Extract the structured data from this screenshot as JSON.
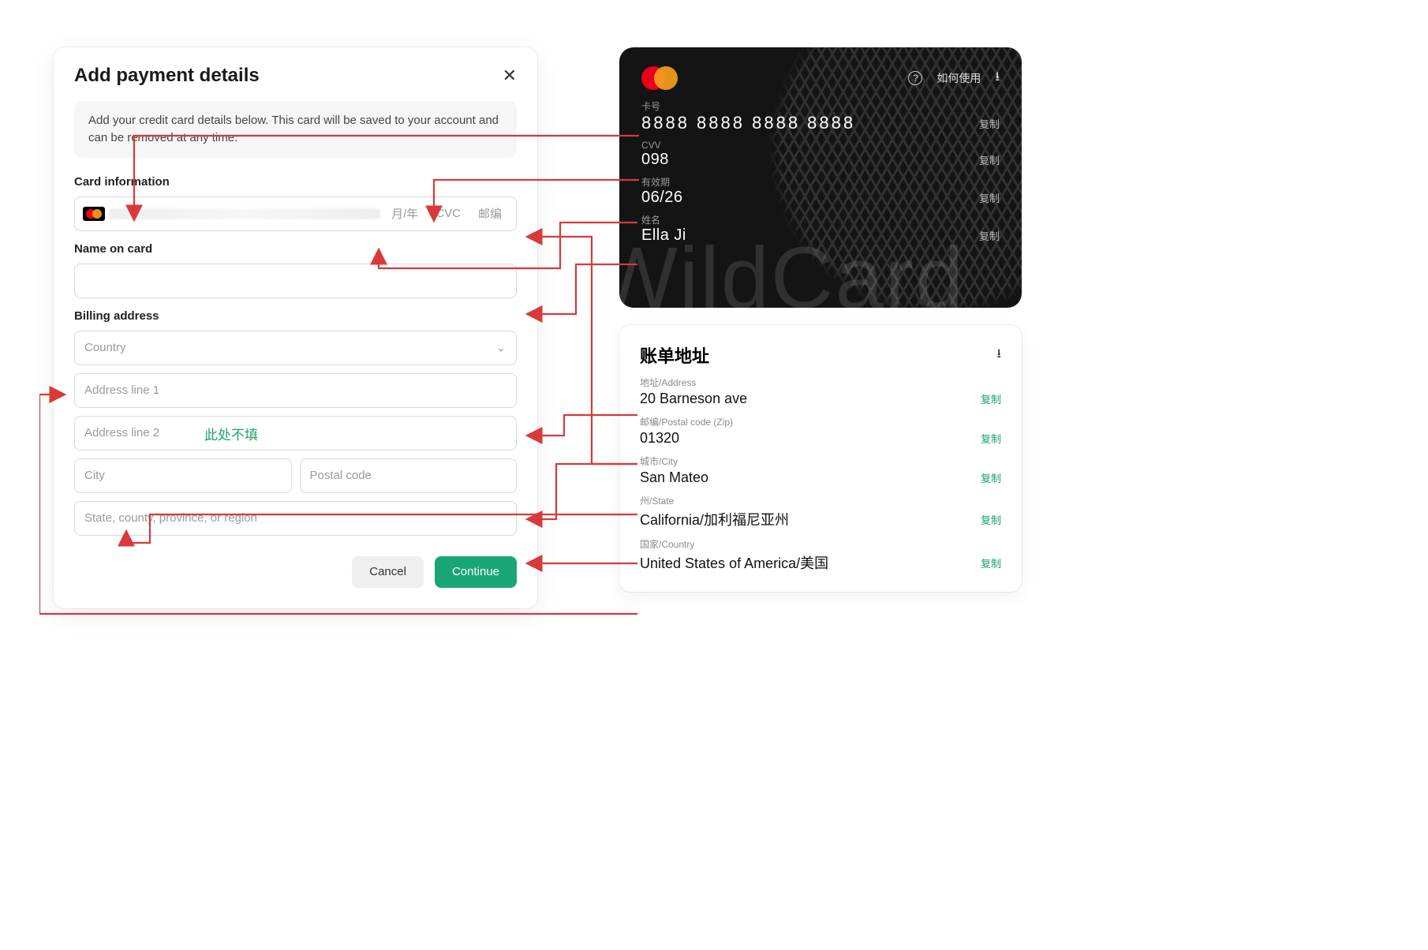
{
  "form": {
    "title": "Add payment details",
    "info": "Add your credit card details below. This card will be saved to your account and can be removed at any time.",
    "card_section_label": "Card information",
    "card_ph_monthyear": "月/年",
    "card_ph_cvc": "CVC",
    "card_ph_zip": "邮编",
    "name_section_label": "Name on card",
    "billing_section_label": "Billing address",
    "country_placeholder": "Country",
    "address1_placeholder": "Address line 1",
    "address2_placeholder": "Address line 2",
    "address2_note": "此处不填",
    "city_placeholder": "City",
    "postal_placeholder": "Postal code",
    "state_placeholder": "State, county, province, or region",
    "cancel": "Cancel",
    "continue": "Continue"
  },
  "vcard": {
    "howto": "如何使用",
    "number_label": "卡号",
    "number": "8888 8888 8888 8888",
    "cvv_label": "CVV",
    "cvv": "098",
    "exp_label": "有效期",
    "exp": "06/26",
    "name_label": "姓名",
    "name": "Ella Ji",
    "copy": "复制",
    "brand": "WildCard"
  },
  "billing": {
    "title": "账单地址",
    "address_label": "地址/Address",
    "address": "20 Barneson ave",
    "postal_label": "邮编/Postal code (Zip)",
    "postal": "01320",
    "city_label": "城市/City",
    "city": "San Mateo",
    "state_label": "州/State",
    "state": "California/加利福尼亚州",
    "country_label": "国家/Country",
    "country": "United States of America/美国",
    "copy": "复制"
  }
}
